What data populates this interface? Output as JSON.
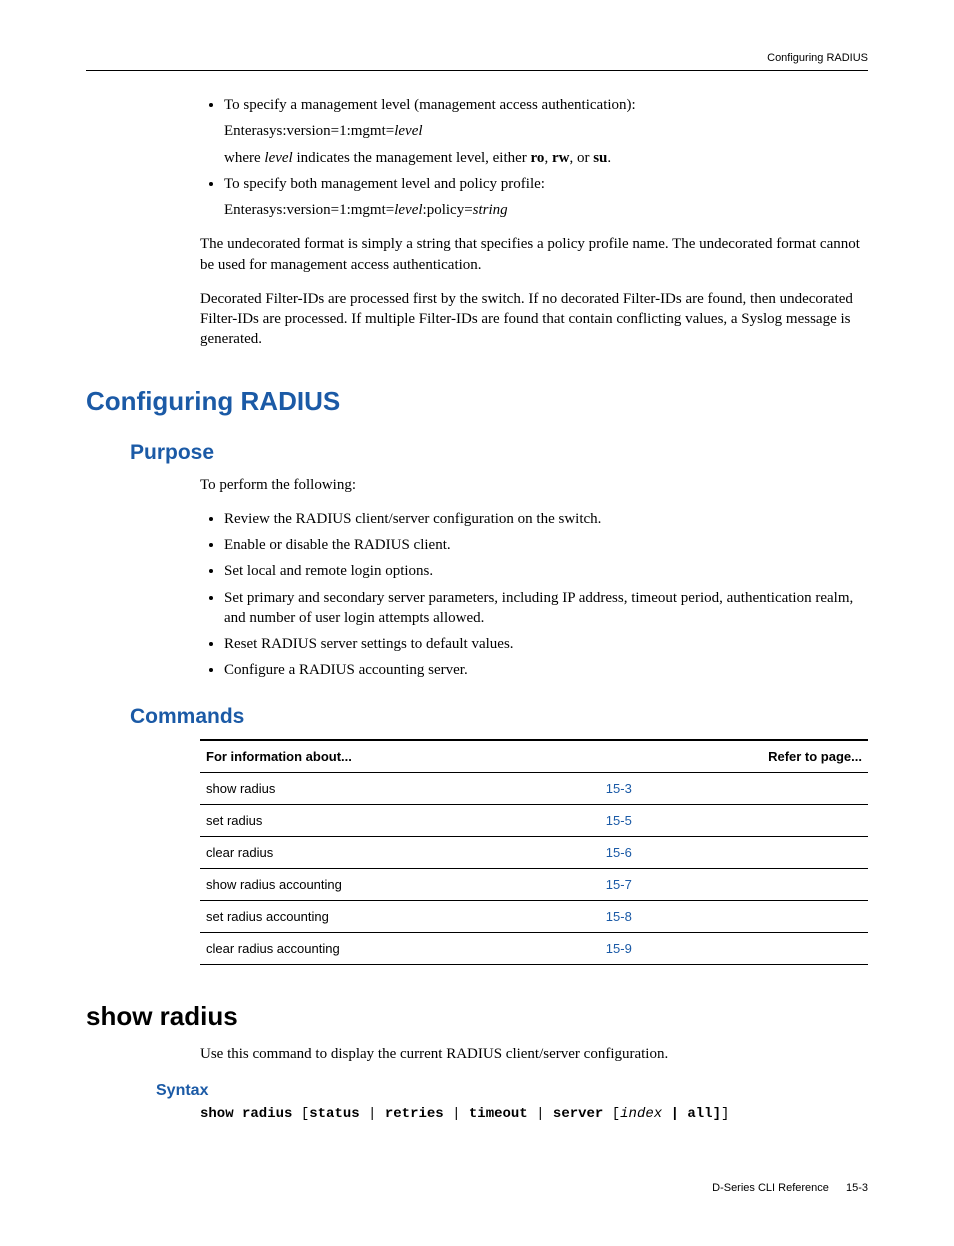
{
  "header": {
    "running": "Configuring RADIUS"
  },
  "intro": {
    "bullet1": {
      "lead": "To specify a management level (management access authentication):",
      "syntax_prefix": "Enterasys:version=1:mgmt=",
      "syntax_italic": "level",
      "desc_pre": "where ",
      "desc_italic": "level",
      "desc_mid": " indicates the management level, either ",
      "ro": "ro",
      "comma1": ", ",
      "rw": "rw",
      "comma2": ", or ",
      "su": "su",
      "period": "."
    },
    "bullet2": {
      "lead": "To specify both management level and policy profile:",
      "syntax_prefix": "Enterasys:version=1:mgmt=",
      "syntax_i1": "level",
      "syntax_mid": ":policy=",
      "syntax_i2": "string"
    },
    "para1": "The undecorated format is simply a string that specifies a policy profile name. The undecorated format cannot be used for management access authentication.",
    "para2": "Decorated Filter-IDs are processed first by the switch. If no decorated Filter-IDs are found, then undecorated Filter-IDs are processed. If multiple Filter-IDs are found that contain conflicting values, a Syslog message is generated."
  },
  "h1": "Configuring RADIUS",
  "purpose": {
    "heading": "Purpose",
    "lead": "To perform the following:",
    "items": [
      "Review the RADIUS client/server configuration on the switch.",
      "Enable or disable the RADIUS client.",
      "Set local and remote login options.",
      "Set primary and secondary server parameters, including IP address, timeout period, authentication realm, and number of user login attempts allowed.",
      "Reset RADIUS server settings to default values.",
      "Configure a RADIUS accounting server."
    ]
  },
  "commands": {
    "heading": "Commands",
    "col1": "For information about...",
    "col2": "Refer to page...",
    "rows": [
      {
        "name": "show radius",
        "page": "15-3"
      },
      {
        "name": "set radius",
        "page": "15-5"
      },
      {
        "name": "clear radius",
        "page": "15-6"
      },
      {
        "name": "show radius accounting",
        "page": "15-7"
      },
      {
        "name": "set radius accounting",
        "page": "15-8"
      },
      {
        "name": "clear radius accounting",
        "page": "15-9"
      }
    ]
  },
  "showradius": {
    "heading": "show radius",
    "desc": "Use this command to display the current RADIUS client/server configuration.",
    "syntax_heading": "Syntax",
    "syntax_parts": {
      "p1": "show radius ",
      "p2": "[",
      "p3": "status ",
      "p4": "| ",
      "p5": "retries ",
      "p6": "| ",
      "p7": "timeout ",
      "p8": "| ",
      "p9": "server ",
      "p10": "[",
      "p11": "index ",
      "p12": "| all]",
      "p13": "]"
    }
  },
  "footer": {
    "doc": "D-Series CLI Reference",
    "page": "15-3"
  }
}
